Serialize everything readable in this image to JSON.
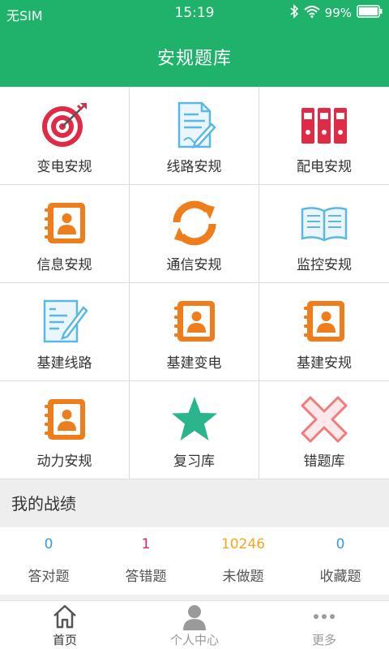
{
  "status_bar": {
    "carrier": "无SIM",
    "time": "15:19",
    "battery": "99%"
  },
  "header": {
    "title": "安规题库"
  },
  "categories": [
    {
      "label": "变电安规",
      "icon": "target-icon"
    },
    {
      "label": "线路安规",
      "icon": "document-pen-icon"
    },
    {
      "label": "配电安规",
      "icon": "binders-icon"
    },
    {
      "label": "信息安规",
      "icon": "contact-book-icon"
    },
    {
      "label": "通信安规",
      "icon": "refresh-icon"
    },
    {
      "label": "监控安规",
      "icon": "open-book-icon"
    },
    {
      "label": "基建线路",
      "icon": "notepad-pen-icon"
    },
    {
      "label": "基建变电",
      "icon": "contact-book-icon"
    },
    {
      "label": "基建安规",
      "icon": "contact-book-icon"
    },
    {
      "label": "动力安规",
      "icon": "contact-book-icon"
    },
    {
      "label": "复习库",
      "icon": "star-icon"
    },
    {
      "label": "错题库",
      "icon": "cross-icon"
    }
  ],
  "record": {
    "title": "我的战绩",
    "stats": [
      {
        "value": "0",
        "label": "答对题",
        "color": "#3a9ad9"
      },
      {
        "value": "1",
        "label": "答错题",
        "color": "#e0245e"
      },
      {
        "value": "10246",
        "label": "未做题",
        "color": "#f5a623"
      },
      {
        "value": "0",
        "label": "收藏题",
        "color": "#3a9ad9"
      }
    ]
  },
  "tabbar": {
    "items": [
      {
        "label": "首页",
        "icon": "home-icon"
      },
      {
        "label": "个人中心",
        "icon": "person-icon"
      },
      {
        "label": "更多",
        "icon": "more-icon"
      }
    ]
  },
  "colors": {
    "brand": "#1fb26b",
    "orange": "#ee7d1b",
    "blue": "#5bb8e0",
    "red": "#e02b47",
    "teal": "#2bb58e",
    "pink": "#ef7b7b"
  }
}
